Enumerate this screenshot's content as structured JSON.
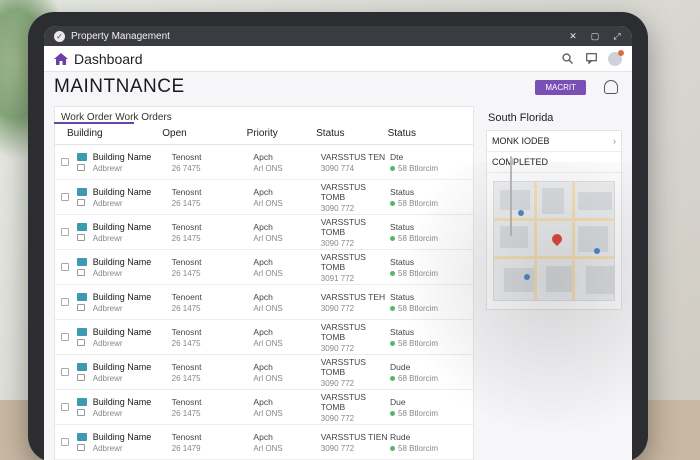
{
  "app": {
    "title": "Property Management"
  },
  "header": {
    "title": "Dashboard"
  },
  "page": {
    "title": "MAINTNANCE",
    "action_label": "MACRIT"
  },
  "table": {
    "title": "Work Order Work Orders",
    "columns": [
      "Building",
      "Open",
      "Priority",
      "Status",
      "Status"
    ],
    "rows": [
      {
        "name": "Building Name",
        "addr": "Adbrewr",
        "open1": "Tenosnt",
        "open2": "26 7475",
        "pri1": "Apch",
        "pri2": "Arl ONS",
        "st1": "VARSSTUS TEN",
        "st2": "3090 774",
        "s1": "Dte",
        "s2": "58 Btlorcim"
      },
      {
        "name": "Building Name",
        "addr": "Adbrewr",
        "open1": "Tenosnt",
        "open2": "26 1475",
        "pri1": "Apch",
        "pri2": "Arl ONS",
        "st1": "VARSSTUS TOMB",
        "st2": "3090 772",
        "s1": "Status",
        "s2": "58 Btlorcim"
      },
      {
        "name": "Building Name",
        "addr": "Adbrewr",
        "open1": "Tenosnt",
        "open2": "26 1475",
        "pri1": "Apch",
        "pri2": "Arl ONS",
        "st1": "VARSSTUS TOMB",
        "st2": "3090 772",
        "s1": "Status",
        "s2": "58 Btlorcim"
      },
      {
        "name": "Building Name",
        "addr": "Adbrewr",
        "open1": "Tenosnt",
        "open2": "26 1475",
        "pri1": "Apch",
        "pri2": "Arl ONS",
        "st1": "VARSSTUS TOMB",
        "st2": "3091 772",
        "s1": "Status",
        "s2": "58 Btlorcim"
      },
      {
        "name": "Building Name",
        "addr": "Adbrewr",
        "open1": "Tenoent",
        "open2": "26 1475",
        "pri1": "Apch",
        "pri2": "Arl ONS",
        "st1": "VARSSTUS TEH",
        "st2": "3090 772",
        "s1": "Status",
        "s2": "58 Btlorcim"
      },
      {
        "name": "Building Name",
        "addr": "Adbrewr",
        "open1": "Tenosnt",
        "open2": "26 1475",
        "pri1": "Apch",
        "pri2": "Arl ONS",
        "st1": "VARSSTUS TOMB",
        "st2": "3090 772",
        "s1": "Status",
        "s2": "58 Btlorcim"
      },
      {
        "name": "Building Name",
        "addr": "Adbrewr",
        "open1": "Tenosnt",
        "open2": "26 1475",
        "pri1": "Apch",
        "pri2": "Arl ONS",
        "st1": "VARSSTUS TOMB",
        "st2": "3090 772",
        "s1": "Dude",
        "s2": "68 Btlorcim"
      },
      {
        "name": "Building Name",
        "addr": "Adbrewr",
        "open1": "Tenosnt",
        "open2": "26 1475",
        "pri1": "Apch",
        "pri2": "Arl ONS",
        "st1": "VARSSTUS TOMB",
        "st2": "3090 772",
        "s1": "Due",
        "s2": "58 Btlorcim"
      },
      {
        "name": "Building Name",
        "addr": "Adbrewr",
        "open1": "Tenosnt",
        "open2": "26 1479",
        "pri1": "Apch",
        "pri2": "Arl ONS",
        "st1": "VARSSTUS TIEN",
        "st2": "3090 772",
        "s1": "Rude",
        "s2": "58 Btlorcim"
      }
    ]
  },
  "side": {
    "region": "South Florida",
    "item1": "MONK IODEB",
    "item2": "COMPLETED"
  },
  "colors": {
    "accent": "#7a4fb6",
    "icon": "#3e9ab1",
    "pin": "#e2463a",
    "ok": "#5bb46a"
  },
  "icons": [
    "home-icon",
    "search-icon",
    "chat-icon",
    "bell-icon",
    "pin-icon",
    "building-icon",
    "chevron-right-icon"
  ]
}
